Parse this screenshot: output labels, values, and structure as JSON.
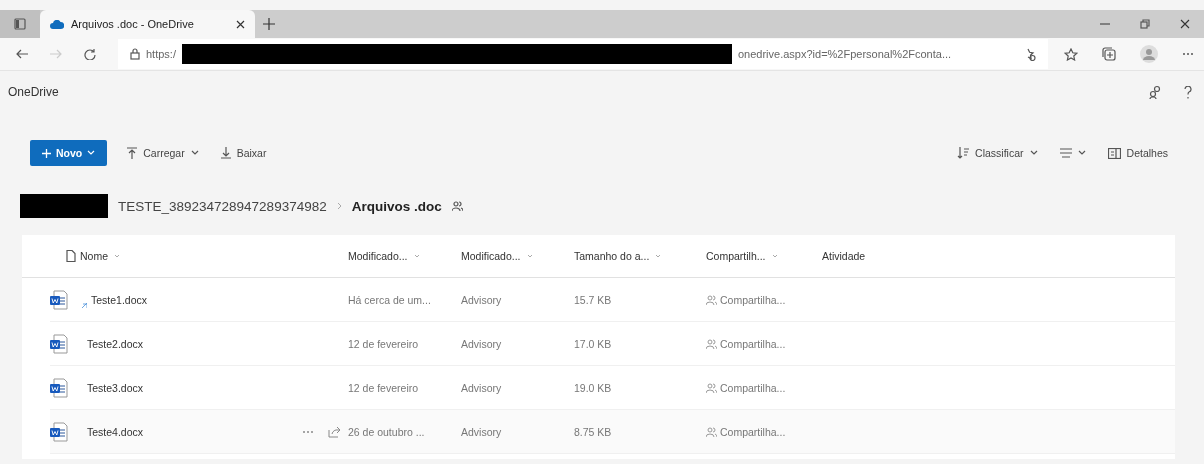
{
  "browser": {
    "tab": {
      "title": "Arquivos .doc - OneDrive",
      "selected": true
    },
    "url": {
      "prefix": "https:/",
      "suffix": "onedrive.aspx?id=%2Fpersonal%2Fconta..."
    }
  },
  "app": {
    "title": "OneDrive"
  },
  "toolbar": {
    "left": [
      {
        "kind": "new",
        "label": "Novo"
      },
      {
        "kind": "upload",
        "label": "Carregar"
      },
      {
        "kind": "download",
        "label": "Baixar"
      }
    ],
    "right": [
      {
        "kind": "sort",
        "label": "Classificar"
      },
      {
        "kind": "view"
      },
      {
        "kind": "details",
        "label": "Detalhes"
      }
    ]
  },
  "breadcrumb": [
    {
      "text": "TESTE_389234728947289374982",
      "current": false
    },
    {
      "text": "Arquivos .doc",
      "current": true
    }
  ],
  "table": {
    "columns": [
      {
        "label": "Nome",
        "sortable": true
      },
      {
        "label": "Modificado...",
        "sortable": true
      },
      {
        "label": "Modificado...",
        "sortable": true
      },
      {
        "label": "Tamanho do a...",
        "sortable": true
      },
      {
        "label": "Compartilh...",
        "sortable": true
      },
      {
        "label": "Atividade",
        "sortable": false
      }
    ],
    "rows": [
      {
        "name": "Teste1.docx",
        "modified": "Há cerca de um...",
        "modified_by": "Advisory",
        "size": "15.7 KB",
        "sharing": "Compartilha...",
        "is_new": true,
        "hovered": false
      },
      {
        "name": "Teste2.docx",
        "modified": "12 de fevereiro",
        "modified_by": "Advisory",
        "size": "17.0 KB",
        "sharing": "Compartilha...",
        "is_new": false,
        "hovered": false
      },
      {
        "name": "Teste3.docx",
        "modified": "12 de fevereiro",
        "modified_by": "Advisory",
        "size": "19.0 KB",
        "sharing": "Compartilha...",
        "is_new": false,
        "hovered": false
      },
      {
        "name": "Teste4.docx",
        "modified": "26 de outubro ...",
        "modified_by": "Advisory",
        "size": "8.75 KB",
        "sharing": "Compartilha...",
        "is_new": false,
        "hovered": true
      }
    ]
  }
}
